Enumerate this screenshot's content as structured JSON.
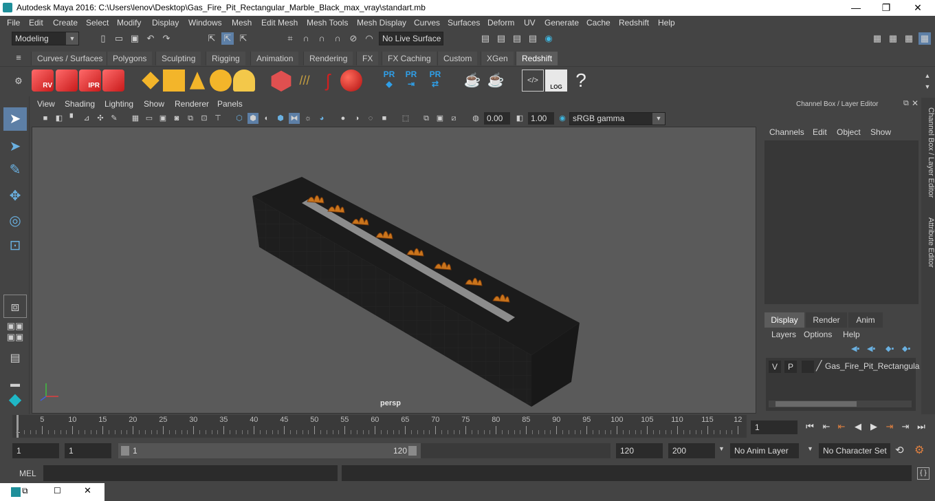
{
  "window": {
    "title": "Autodesk Maya 2016: C:\\Users\\lenov\\Desktop\\Gas_Fire_Pit_Rectangular_Marble_Black_max_vray\\standart.mb",
    "minimize": "—",
    "maximize": "❐",
    "close": "✕"
  },
  "menu": [
    "File",
    "Edit",
    "Create",
    "Select",
    "Modify",
    "Display",
    "Windows",
    "Mesh",
    "Edit Mesh",
    "Mesh Tools",
    "Mesh Display",
    "Curves",
    "Surfaces",
    "Deform",
    "UV",
    "Generate",
    "Cache",
    "Redshift",
    "Help"
  ],
  "status_line": {
    "mode": "Modeling",
    "live_surface": "No Live Surface"
  },
  "shelf_tabs": [
    "Curves / Surfaces",
    "Polygons",
    "Sculpting",
    "Rigging",
    "Animation",
    "Rendering",
    "FX",
    "FX Caching",
    "Custom",
    "XGen",
    "Redshift"
  ],
  "active_shelf_tab": "Redshift",
  "shelf_icons": {
    "rv": "RV",
    "ipr": "IPR",
    "pr1": "PR",
    "pr2": "PR",
    "pr3": "PR",
    "log": "LOG",
    "help": "?"
  },
  "panel_menu": [
    "View",
    "Shading",
    "Lighting",
    "Show",
    "Renderer",
    "Panels"
  ],
  "panel_toolbar": {
    "exposure": "0.00",
    "gamma": "1.00",
    "color_space": "sRGB gamma"
  },
  "viewport": {
    "camera_label": "persp"
  },
  "channel_box": {
    "header": "Channel Box / Layer Editor",
    "menu": [
      "Channels",
      "Edit",
      "Object",
      "Show"
    ],
    "layer_tabs": [
      "Display",
      "Render",
      "Anim"
    ],
    "active_layer_tab": "Display",
    "layer_menu": [
      "Layers",
      "Options",
      "Help"
    ],
    "layer_row": {
      "v": "V",
      "p": "P",
      "name": "Gas_Fire_Pit_Rectangula"
    }
  },
  "side_tabs": [
    "Channel Box / Layer Editor",
    "Attribute Editor"
  ],
  "time_slider": {
    "ticks": [
      5,
      10,
      15,
      20,
      25,
      30,
      35,
      40,
      45,
      50,
      55,
      60,
      65,
      70,
      75,
      80,
      85,
      90,
      95,
      100,
      105,
      110,
      115,
      12
    ],
    "start_label": "1",
    "current_frame": "1"
  },
  "range_slider": {
    "start": "1",
    "playback_start": "1",
    "range_start_label": "1",
    "range_end_label": "120",
    "playback_end": "120",
    "end": "200",
    "anim_layer": "No Anim Layer",
    "character_set": "No Character Set"
  },
  "command_line": {
    "label": "MEL"
  }
}
